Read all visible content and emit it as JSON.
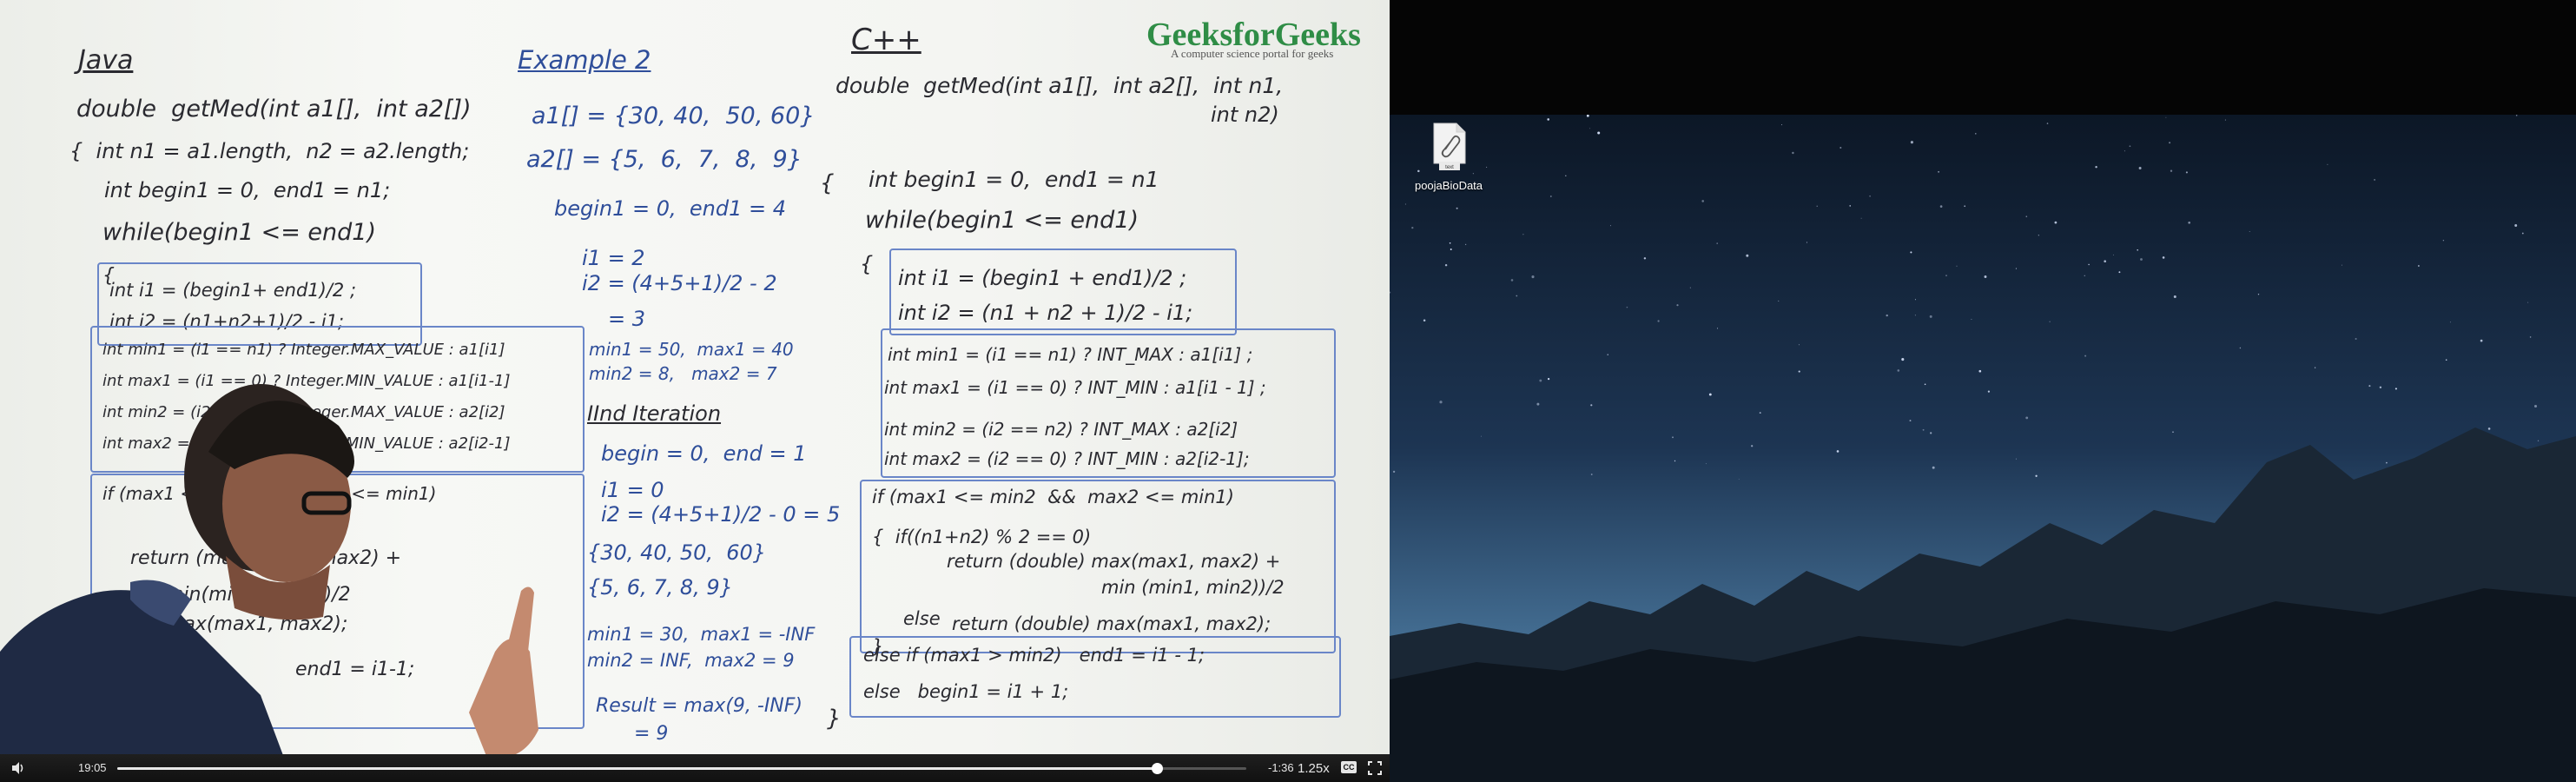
{
  "video": {
    "logo_text": "GeeksforGeeks",
    "logo_tagline": "A computer science portal for geeks",
    "board": {
      "java": [
        "Java",
        "double  getMed(int a1[],  int a2[])",
        "{  int n1 = a1.length,  n2 = a2.length;",
        "int begin1 = 0,  end1 = n1;",
        "while(begin1 <= end1)",
        "{",
        "int i1 = (begin1+ end1)/2 ;",
        "int i2 = (n1+n2+1)/2 - i1;",
        "int min1 = (i1 == n1) ? Integer.MAX_VALUE : a1[i1]",
        "int max1 = (i1 == 0) ? Integer.MIN_VALUE : a1[i1-1]",
        "int min2 = (i2 == n2) ? Integer.MAX_VALUE : a2[i2]",
        "int max2 = (i2 == 0) ? Integer.MIN_VALUE : a2[i2-1]",
        "if (max1 <= min2 && max2 <= min1)",
        "return (max(max1, max2) +",
        "min(min1, min2))/2",
        "max(max1, max2);",
        "end1 = i1-1;"
      ],
      "example": [
        "Example 2",
        "a1[] = {30, 40,  50, 60}",
        "a2[] = {5,  6,  7,  8,  9}",
        "begin1 = 0,  end1 = 4",
        "i1 = 2",
        "i2 = (4+5+1)/2 - 2",
        "= 3",
        "min1 = 50,  max1 = 40",
        "min2 = 8,   max2 = 7",
        "IInd Iteration",
        "begin = 0,  end = 1",
        "i1 = 0",
        "i2 = (4+5+1)/2 - 0 = 5",
        "{30, 40, 50,  60}",
        "{5, 6, 7, 8, 9}",
        "min1 = 30,  max1 = -INF",
        "min2 = INF,  max2 = 9",
        "Result = max(9, -INF)",
        "= 9"
      ],
      "cpp": [
        "C++",
        "double  getMed(int a1[],  int a2[],  int n1,",
        "int n2)",
        "{",
        "int begin1 = 0,  end1 = n1",
        "while(begin1 <= end1)",
        "{",
        "int i1 = (begin1 + end1)/2 ;",
        "int i2 = (n1 + n2 + 1)/2 - i1;",
        "int min1 = (i1 == n1) ? INT_MAX : a1[i1] ;",
        "int max1 = (i1 == 0) ? INT_MIN : a1[i1 - 1] ;",
        "int min2 = (i2 == n2) ? INT_MAX : a2[i2]",
        "int max2 = (i2 == 0) ? INT_MIN : a2[i2-1];",
        "if (max1 <= min2  &&  max2 <= min1)",
        "{  if((n1+n2) % 2 == 0)",
        "return (double) max(max1, max2) +",
        "min (min1, min2))/2",
        "else",
        "return (double) max(max1, max2);",
        "}",
        "else if (max1 > min2)   end1 = i1 - 1;",
        "else   begin1 = i1 + 1;",
        "}"
      ]
    },
    "controls": {
      "elapsed": "19:05",
      "remaining": "-1:36",
      "speed": "1.25x",
      "cc_label": "CC",
      "progress_fraction": 0.9207,
      "volume_icon": "volume-icon",
      "fullscreen_icon": "fullscreen-icon"
    }
  },
  "desktop": {
    "file": {
      "name": "poojaBioData",
      "type_label": "text",
      "icon": "paperclip-icon"
    }
  }
}
